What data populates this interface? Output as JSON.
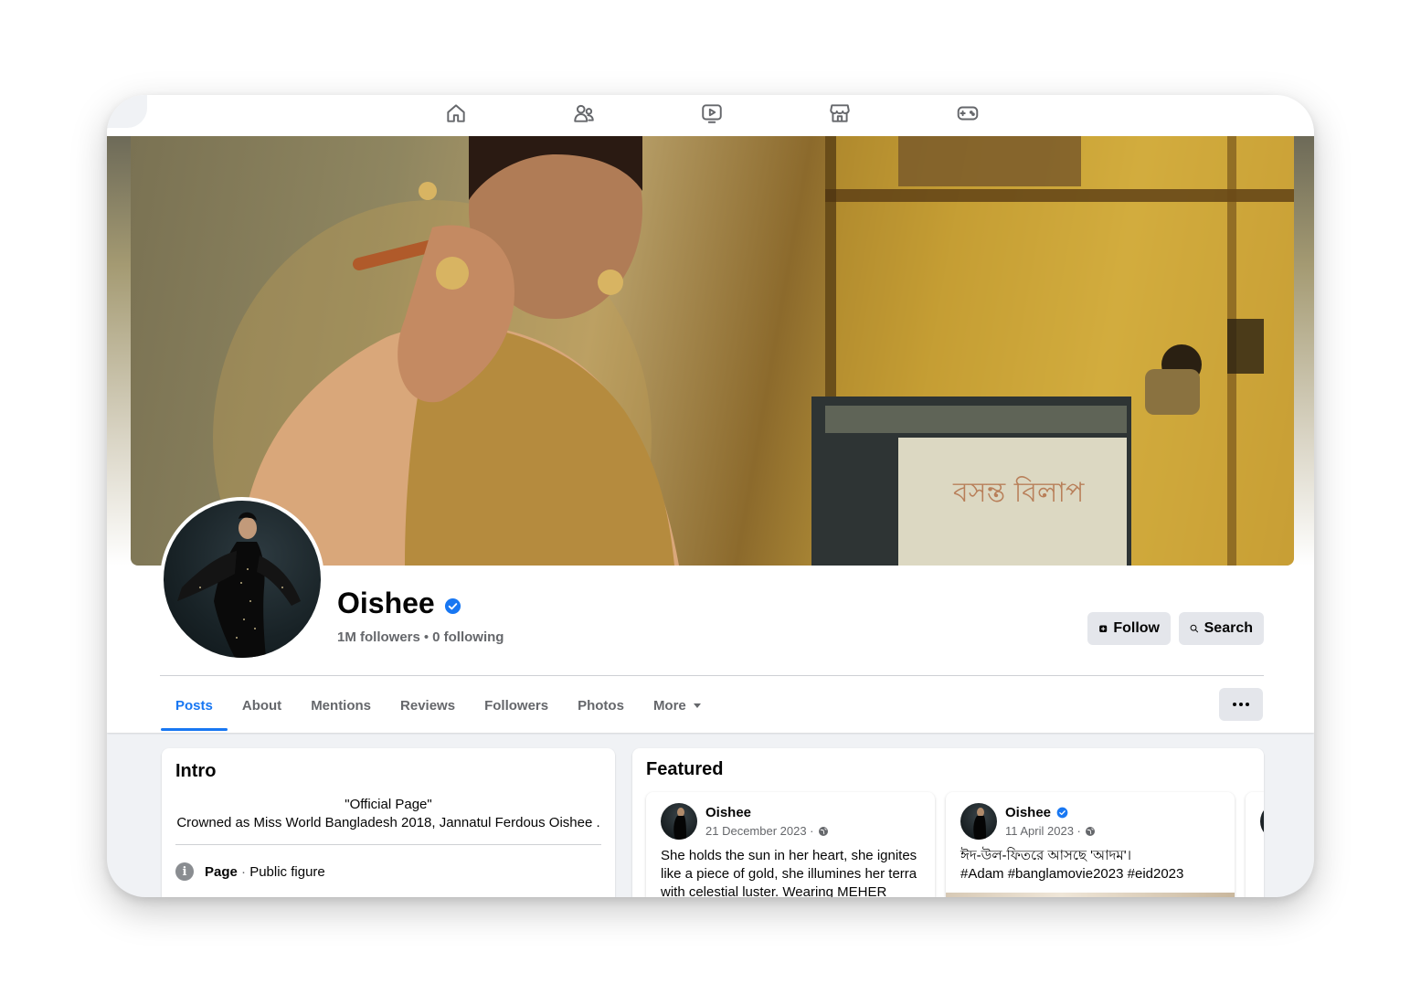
{
  "nav": {
    "icons": [
      "home-icon",
      "friends-icon",
      "watch-icon",
      "marketplace-icon",
      "gaming-icon"
    ]
  },
  "profile": {
    "name": "Oishee",
    "verified": true,
    "followers": "1M followers",
    "separator": "•",
    "following": "0 following"
  },
  "actions": {
    "follow_label": "Follow",
    "search_label": "Search"
  },
  "tabs": [
    {
      "label": "Posts",
      "active": true
    },
    {
      "label": "About"
    },
    {
      "label": "Mentions"
    },
    {
      "label": "Reviews"
    },
    {
      "label": "Followers"
    },
    {
      "label": "Photos"
    },
    {
      "label": "More"
    }
  ],
  "intro": {
    "title": "Intro",
    "quote": "\"Official Page\"",
    "bio": "Crowned as Miss World Bangladesh 2018, Jannatul Ferdous Oishee .",
    "category_label": "Page",
    "category_sep": " · ",
    "category_value": "Public figure"
  },
  "featured": {
    "title": "Featured",
    "posts": [
      {
        "author": "Oishee",
        "date": "21 December 2023 ·",
        "text": "She holds the sun in her heart, she ignites like a piece of gold, she illumines her terra with celestial luster. Wearing MEHER"
      },
      {
        "author": "Oishee",
        "verified": true,
        "date": "11 April 2023 ·",
        "text_line1": "ঈদ-উল-ফিতরে আসছে 'আদম'।",
        "text_line2": "#Adam #banglamovie2023 #eid2023"
      }
    ]
  },
  "colors": {
    "accent": "#1877f2",
    "muted_text": "#65676b",
    "button_bg": "#e4e6eb",
    "page_bg": "#f0f2f5"
  }
}
